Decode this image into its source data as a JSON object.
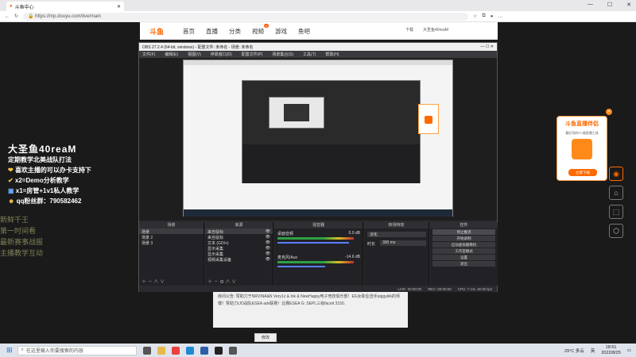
{
  "browser": {
    "tab_title": "斗鱼中心",
    "url": "https://mp.douyu.com/live/main",
    "address_right": "下载",
    "user": "大圣鱼40reaM"
  },
  "douyu_nav": {
    "logo": "斗鱼",
    "items": [
      "首页",
      "直播",
      "分类",
      "视频",
      "游戏",
      "鱼吧"
    ],
    "badge": "4"
  },
  "left_info": {
    "name": "大圣鱼40reaM",
    "lines": [
      "定期教学北美战队打法",
      "喜欢主播的可以办卡支持下",
      "x2=Demo分析教学",
      "x1=房管+1v1私人教学",
      "qq粉丝群：790582462"
    ]
  },
  "ghost_text": [
    "新鲜千王",
    "第一时间看",
    "最新赛事战报",
    "主播教学互动"
  ],
  "obs": {
    "title": "OBS 27.2.4 (64-bit, windows) - 配置文件: 未命名 - 场景: 未命名",
    "menu": [
      "文件(F)",
      "编辑(E)",
      "视图(V)",
      "停靠窗口(D)",
      "配置文件(P)",
      "场景集合(S)",
      "工具(T)",
      "帮助(H)"
    ],
    "scenes_header": "场景",
    "scenes": [
      "场景",
      "场景 2",
      "场景 3"
    ],
    "sources_header": "来源",
    "sources": [
      "来自鼠标",
      "来自鼠标",
      "文本 (GDI+)",
      "显示采集",
      "显示采集",
      "视频采集设备"
    ],
    "mixer_header": "混音器",
    "mixer": [
      {
        "name": "桌面音频",
        "db": "0.0 dB"
      },
      {
        "name": "麦克风/Aux",
        "db": "-14.6 dB"
      }
    ],
    "transition_header": "转场特效",
    "transition": {
      "type": "淡化",
      "duration_label": "时长",
      "duration": "300 ms"
    },
    "controls_header": "控件",
    "controls": [
      "停止推流",
      "开始录制",
      "启动虚拟摄像机",
      "工作室模式",
      "设置",
      "退出"
    ],
    "status": [
      "LIVE: 00:00:00",
      "REC: 00:00:00",
      "CPU: 7.1%, 60.00 fps"
    ]
  },
  "announcement": {
    "label": "房间公告:",
    "text": "赞助力于NRVINA&N Very1z & Ink & NewHappy电子竞技俱乐部！EG女职业选手piggyklk的师傅！赞助力IJO战队ESEA adv联赛！比赛ESEA G: SEPL三级faceit 3150.",
    "edit_button": "修改"
  },
  "right_card": {
    "title": "斗鱼直播伴侣",
    "sub": "最好用的PC端直播工具",
    "button": "立即下载"
  },
  "taskbar": {
    "search_placeholder": "在这里输入你要搜索的内容",
    "weather": "29°C 多云",
    "time": "18:51",
    "date": "2022/8/25",
    "lang": "英"
  }
}
